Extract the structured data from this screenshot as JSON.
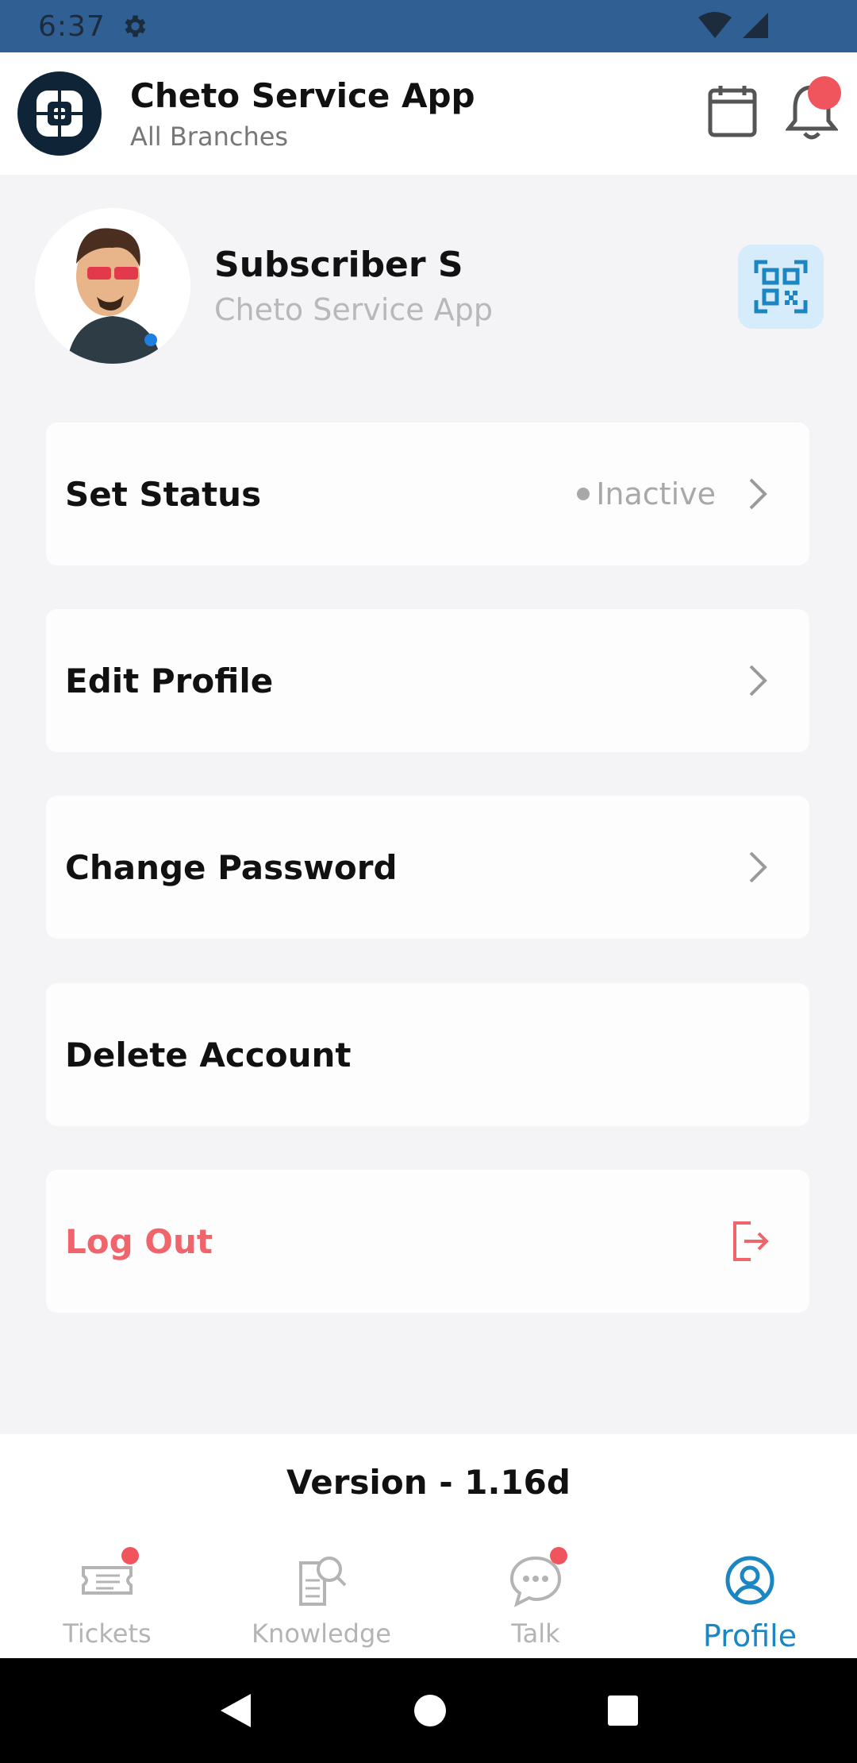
{
  "status_bar": {
    "time": "6:37"
  },
  "header": {
    "title": "Cheto Service App",
    "subtitle": "All Branches"
  },
  "profile": {
    "name": "Subscriber S",
    "organization": "Cheto Service App"
  },
  "menu": {
    "set_status_label": "Set Status",
    "status_value": "Inactive",
    "edit_profile_label": "Edit Profile",
    "change_password_label": "Change Password",
    "delete_account_label": "Delete Account",
    "logout_label": "Log Out"
  },
  "version": {
    "text": "Version - 1.16d"
  },
  "bottom_nav": {
    "items": [
      {
        "label": "Tickets",
        "icon": "ticket-icon",
        "badge": true
      },
      {
        "label": "Knowledge",
        "icon": "knowledge-search-icon",
        "badge": false
      },
      {
        "label": "Talk",
        "icon": "chat-bubble-icon",
        "badge": true
      },
      {
        "label": "Profile",
        "icon": "profile-icon",
        "badge": false,
        "active": true
      }
    ]
  },
  "colors": {
    "accent": "#1b86c2",
    "danger": "#f0646c",
    "status_bar": "#2f5f93",
    "qr_bg": "#d7ecfa"
  }
}
